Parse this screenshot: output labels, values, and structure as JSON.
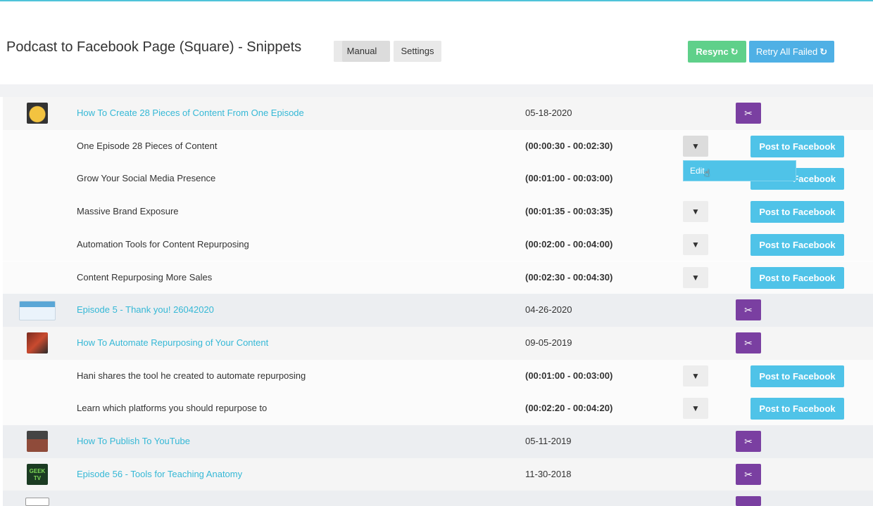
{
  "header": {
    "title": "Podcast to Facebook Page (Square) - Snippets",
    "tabs": [
      {
        "label": "Manual",
        "active": true
      },
      {
        "label": "Settings",
        "active": false
      }
    ],
    "resync_label": "Resync",
    "resync_icon": "refresh-icon",
    "retry_label": "Retry All Failed",
    "retry_icon": "refresh-icon",
    "colors": {
      "resync": "#5fd08a",
      "retry": "#4fb0e5",
      "accent": "#35b8d6",
      "scissor": "#7a3fa1",
      "post": "#4fc3e8"
    }
  },
  "episodes": [
    {
      "title": "How To Create 28 Pieces of Content From One Episode",
      "date": "05-18-2020",
      "snippets": [
        {
          "title": "One Episode 28 Pieces of Content",
          "range": "(00:00:30 - 00:02:30)"
        },
        {
          "title": "Grow Your Social Media Presence",
          "range": "(00:01:00 - 00:03:00)"
        },
        {
          "title": "Massive Brand Exposure",
          "range": "(00:01:35 - 00:03:35)"
        },
        {
          "title": "Automation Tools for Content Repurposing",
          "range": "(00:02:00 - 00:04:00)"
        },
        {
          "title": "Content Repurposing More Sales",
          "range": "(00:02:30 - 00:04:30)"
        }
      ]
    },
    {
      "title": "Episode 5 - Thank you! 26042020",
      "date": "04-26-2020",
      "snippets": []
    },
    {
      "title": "How To Automate Repurposing of Your Content",
      "date": "09-05-2019",
      "snippets": [
        {
          "title": "Hani shares the tool he created to automate repurposing",
          "range": "(00:01:00 - 00:03:00)"
        },
        {
          "title": "Learn which platforms you should repurpose to",
          "range": "(00:02:20 - 00:04:20)"
        }
      ]
    },
    {
      "title": "How To Publish To YouTube",
      "date": "05-11-2019",
      "snippets": []
    },
    {
      "title": "Episode 56 - Tools for Teaching Anatomy",
      "date": "11-30-2018",
      "snippets": []
    }
  ],
  "actions": {
    "post_label": "Post to Facebook",
    "post_label_partial": "Facebook",
    "dropdown_edit": "Edit",
    "thumb_5_text": "GEEK TV"
  }
}
